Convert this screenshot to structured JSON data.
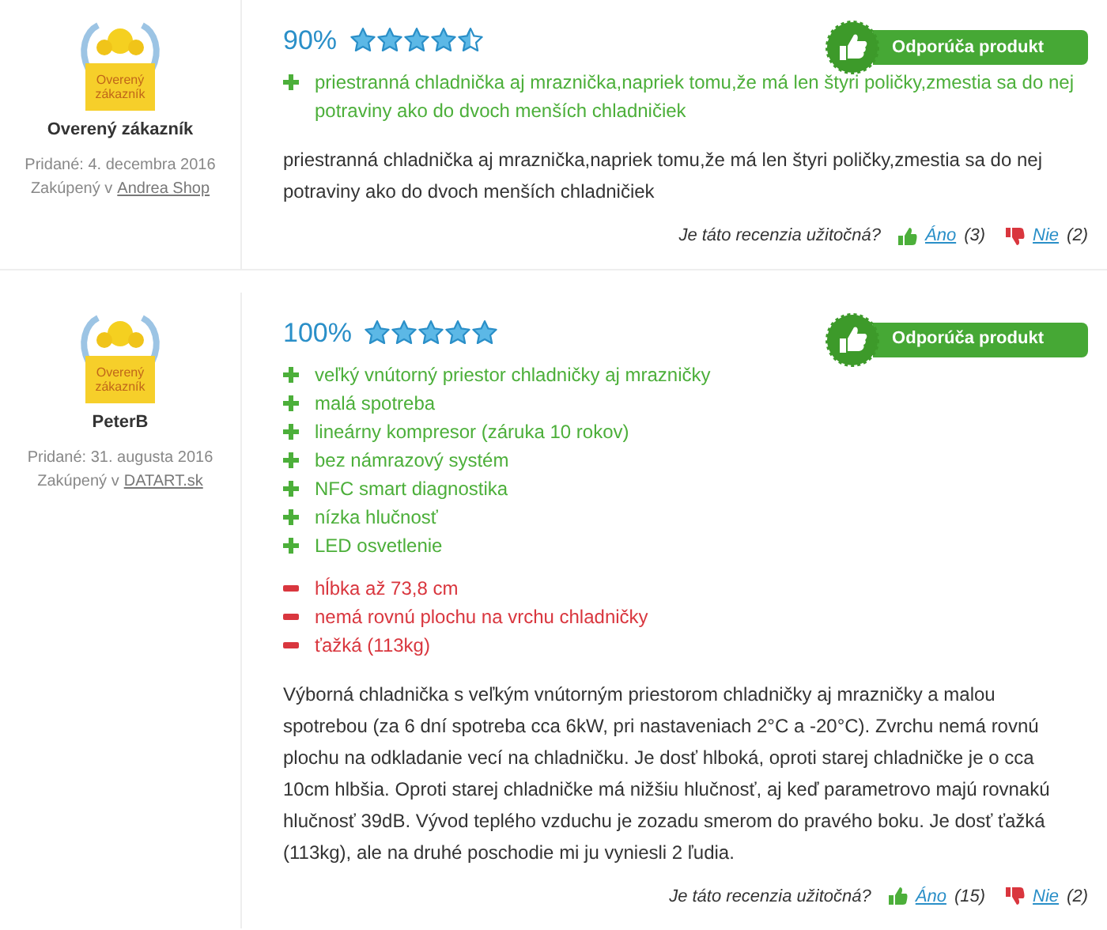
{
  "reviews": [
    {
      "badge_text": "Overený zákazník",
      "author": "Overený zákazník",
      "added": "Pridané: 4. decembra 2016",
      "purchased_prefix": "Zakúpený v",
      "shop": "Andrea Shop",
      "percent": "90%",
      "stars": 4.5,
      "recommend": "Odporúča produkt",
      "points": [
        {
          "kind": "pro",
          "text": "priestranná chladnička aj mraznička,napriek tomu,že má len štyri poličky,zmestia sa do nej potraviny ako do dvoch menších chladničiek"
        }
      ],
      "body": "priestranná chladnička aj mraznička,napriek tomu,že má len štyri poličky,zmestia sa do nej potraviny ako do dvoch menších chladničiek",
      "vote": {
        "question": "Je táto recenzia užitočná?",
        "yes": "Áno",
        "yes_count": "(3)",
        "no": "Nie",
        "no_count": "(2)"
      }
    },
    {
      "badge_text": "Overený zákazník",
      "author": "PeterB",
      "added": "Pridané: 31. augusta 2016",
      "purchased_prefix": "Zakúpený v",
      "shop": "DATART.sk",
      "percent": "100%",
      "stars": 5,
      "recommend": "Odporúča produkt",
      "points": [
        {
          "kind": "pro",
          "text": "veľký vnútorný priestor chladničky aj mrazničky"
        },
        {
          "kind": "pro",
          "text": "malá spotreba"
        },
        {
          "kind": "pro",
          "text": "lineárny kompresor (záruka 10 rokov)"
        },
        {
          "kind": "pro",
          "text": "bez námrazový systém"
        },
        {
          "kind": "pro",
          "text": "NFC smart diagnostika"
        },
        {
          "kind": "pro",
          "text": "nízka hlučnosť"
        },
        {
          "kind": "pro",
          "text": "LED osvetlenie"
        },
        {
          "kind": "con",
          "text": "hĺbka až 73,8 cm"
        },
        {
          "kind": "con",
          "text": "nemá rovnú plochu na vrchu chladničky"
        },
        {
          "kind": "con",
          "text": "ťažká (113kg)"
        }
      ],
      "body": "Výborná chladnička s veľkým vnútorným priestorom chladničky aj mrazničky a malou spotrebou (za 6 dní spotreba cca 6kW, pri nastaveniach 2°C a -20°C). Zvrchu nemá rovnú plochu na odkladanie vecí na chladničku. Je dosť hlboká, oproti starej chladničke je o cca 10cm hlbšia. Oproti starej chladničke má nižšiu hlučnosť, aj keď parametrovo majú rovnakú hlučnosť 39dB. Vývod teplého vzduchu je zozadu smerom do pravého boku. Je dosť ťažká (113kg), ale na druhé poschodie mi ju vyniesli 2 ľudia.",
      "vote": {
        "question": "Je táto recenzia užitočná?",
        "yes": "Áno",
        "yes_count": "(15)",
        "no": "Nie",
        "no_count": "(2)"
      }
    }
  ]
}
